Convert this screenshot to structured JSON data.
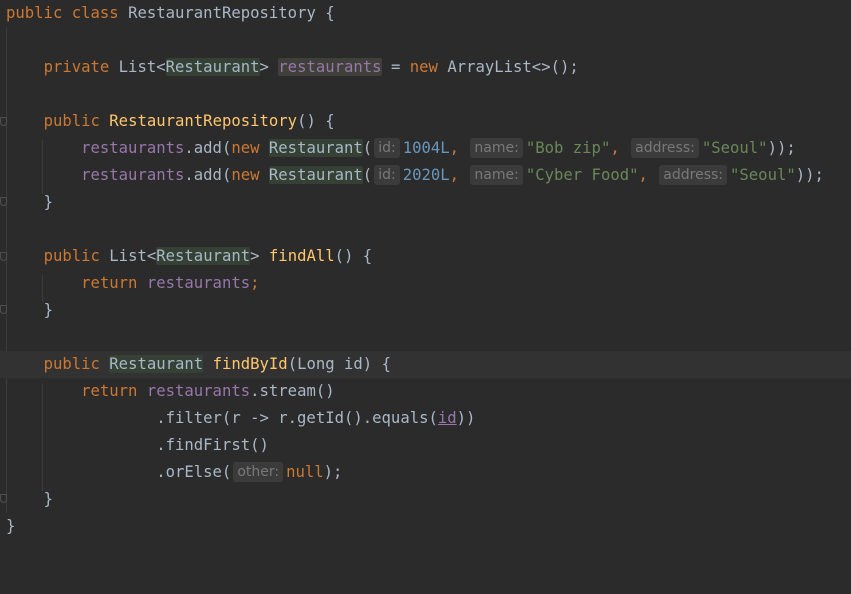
{
  "editor": {
    "class_decl": {
      "kw_public": "public",
      "kw_class": "class",
      "name": "RestaurantRepository",
      "brace": " {"
    },
    "field_decl": {
      "kw_private": "private",
      "type": "List",
      "lt": "<",
      "generic": "Restaurant",
      "gt": ">",
      "name": "restaurants",
      "eq": " = ",
      "kw_new": "new",
      "init": "ArrayList<>();"
    },
    "ctor_decl": {
      "kw_public": "public",
      "name": "RestaurantRepository",
      "rest": "() {"
    },
    "add1": {
      "field": "restaurants",
      "call": ".add(",
      "kw_new": "new",
      "cls": "Restaurant",
      "paren": "(",
      "hint_id": "id:",
      "id_val": "1004L",
      "sep1": ",",
      "hint_name": "name:",
      "name_val": "\"Bob zip\"",
      "sep2": ",",
      "hint_address": "address:",
      "address_val": "\"Seoul\"",
      "end": "));"
    },
    "add2": {
      "field": "restaurants",
      "call": ".add(",
      "kw_new": "new",
      "cls": "Restaurant",
      "paren": "(",
      "hint_id": "id:",
      "id_val": "2020L",
      "sep1": ",",
      "hint_name": "name:",
      "name_val": "\"Cyber Food\"",
      "sep2": ",",
      "hint_address": "address:",
      "address_val": "\"Seoul\"",
      "end": "));"
    },
    "close_brace": "}",
    "findall_decl": {
      "kw_public": "public",
      "type": "List",
      "lt": "<",
      "generic": "Restaurant",
      "gt": ">",
      "name": "findAll",
      "rest": "() {"
    },
    "findall_return": {
      "kw_return": "return",
      "field": "restaurants",
      "semi": ";"
    },
    "findbyid_decl": {
      "kw_public": "public",
      "type": "Restaurant",
      "name": "findById",
      "rest": "(Long id) {"
    },
    "findbyid_return": {
      "kw_return": "return",
      "field": "restaurants",
      "call": ".stream()"
    },
    "filter_line": {
      "pre": ".filter(r -> r.getId().equals(",
      "arg": "id",
      "post": "))"
    },
    "findfirst_line": ".findFirst()",
    "orelse_line": {
      "pre": ".orElse(",
      "hint_other": "other:",
      "null_kw": "null",
      "end": ");"
    }
  }
}
